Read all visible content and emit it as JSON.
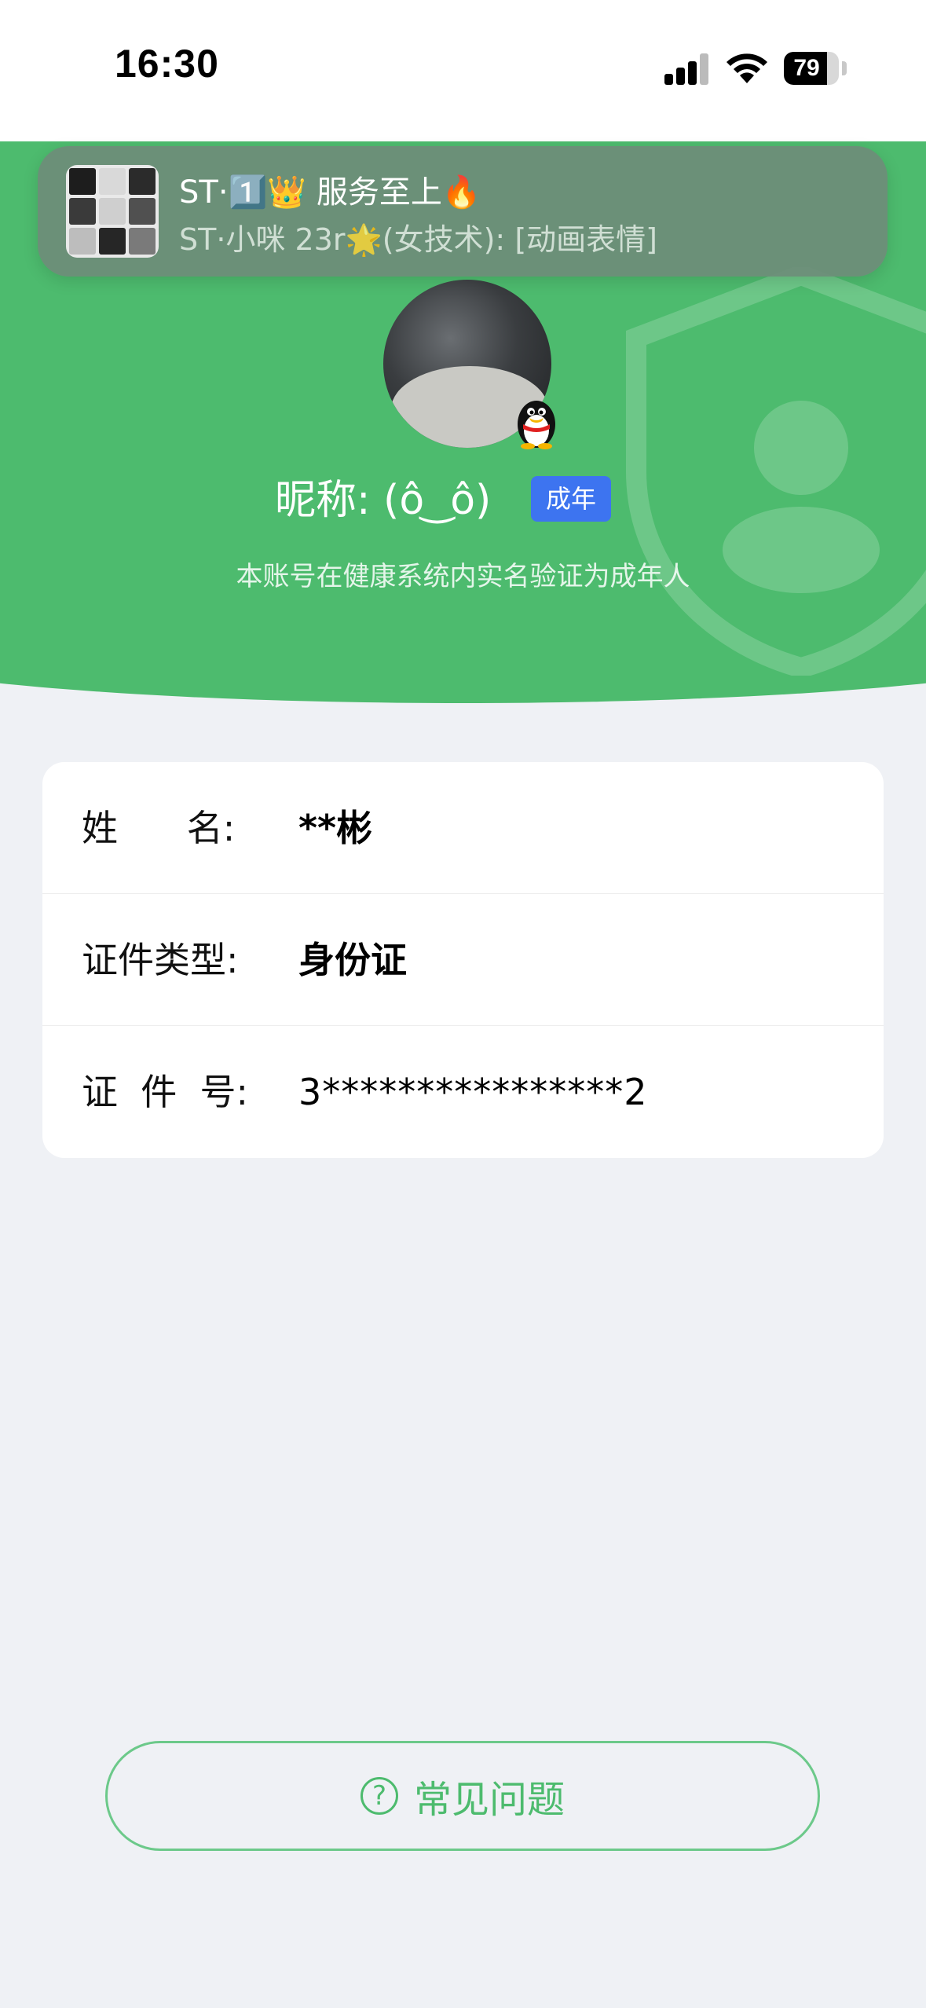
{
  "status_bar": {
    "time": "16:30",
    "battery_level": 79,
    "battery_text": "79",
    "signal_bars": 4
  },
  "notification": {
    "title": "ST·1️⃣👑 服务至上🔥",
    "subtitle": "ST·小咪 23r🌟(女技术): [动画表情]"
  },
  "profile": {
    "nickname": "昵称: (ô ͜ ô)",
    "badge": "成年",
    "verify_text": "本账号在健康系统内实名验证为成年人",
    "avatar_badge_icon": "qq-penguin-icon"
  },
  "info": [
    {
      "label": "姓      名:",
      "value": "**彬"
    },
    {
      "label": "证件类型:",
      "value": "身份证"
    },
    {
      "label": "证  件  号:",
      "value": "3****************2"
    }
  ],
  "faq": {
    "label": "常见问题",
    "icon": "question-circle-icon"
  },
  "colors": {
    "primary_green": "#4dbb6e",
    "badge_blue": "#3d74f0",
    "background": "#eff1f5"
  }
}
